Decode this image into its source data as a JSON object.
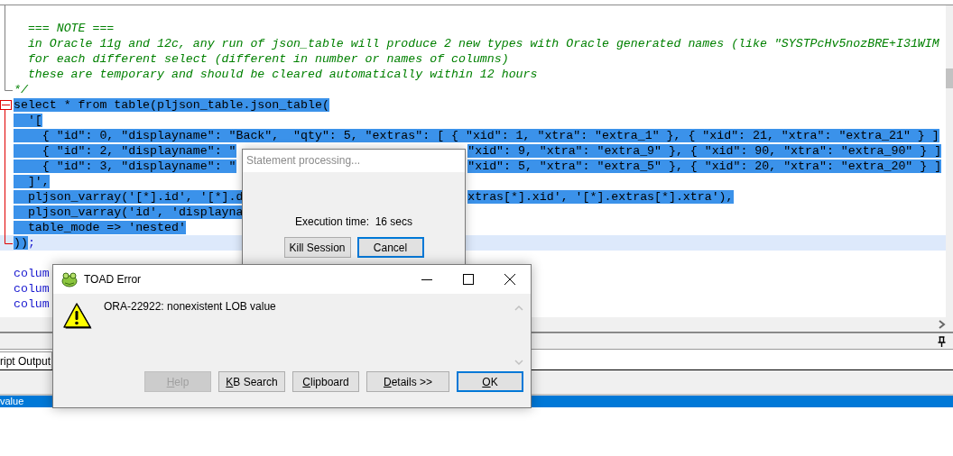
{
  "editor": {
    "lines": [
      {
        "kind": "comment-line"
      },
      {
        "kind": "comment-line",
        "left": [
          {
            "text": "  === NOTE ===",
            "kind": "comment",
            "selected": false
          }
        ]
      },
      {
        "kind": "comment-line",
        "left": [
          {
            "text": "  in Oracle 11g and 12c, any run of json_table will produce 2 new types with Oracle generated names (like \"SYSTPcHv5nozBRE+I31WIM",
            "kind": "comment",
            "selected": false
          }
        ]
      },
      {
        "kind": "comment-line",
        "left": [
          {
            "text": "  for each different select (different in number or names of columns)",
            "kind": "comment",
            "selected": false
          }
        ]
      },
      {
        "kind": "comment-line",
        "left": [
          {
            "text": "  these are temporary and should be cleared automatically within 12 hours",
            "kind": "comment",
            "selected": false
          }
        ]
      },
      {
        "kind": "comment-end",
        "left": [
          {
            "text": "*/",
            "kind": "comment",
            "selected": false
          }
        ]
      },
      {
        "kind": "block-start",
        "left": [
          {
            "text": "select * from table(pljson_table.json_table(",
            "kind": "code",
            "selected": true
          }
        ]
      },
      {
        "kind": "block-line",
        "left": [
          {
            "text": "  '[",
            "kind": "code",
            "selected": true
          }
        ]
      },
      {
        "kind": "block-line",
        "left": [
          {
            "text": "    { \"id\": 0, \"displayname\": \"Back\",  \"qty\": 5, \"extras\": [ { \"xid\": 1, \"xtra\": \"extra_1\" }, { \"xid\": 21, \"xtra\": \"extra_21\" } ]",
            "kind": "code",
            "selected": true
          }
        ]
      },
      {
        "kind": "block-line",
        "left": [
          {
            "text": "    { \"id\": 2, \"displayname\": \"",
            "kind": "code",
            "selected": true
          }
        ],
        "right": [
          {
            "text": "\"xid\": 9, \"xtra\": \"extra_9\" }, { \"xid\": 90, \"xtra\": \"extra_90\" } ]",
            "kind": "code",
            "selected": true
          }
        ]
      },
      {
        "kind": "block-line",
        "left": [
          {
            "text": "    { \"id\": 3, \"displayname\": \"",
            "kind": "code",
            "selected": true
          }
        ],
        "right": [
          {
            "text": "\"xid\": 5, \"xtra\": \"extra_5\" }, { \"xid\": 20, \"xtra\": \"extra_20\" } ]",
            "kind": "code",
            "selected": true
          }
        ]
      },
      {
        "kind": "block-line",
        "left": [
          {
            "text": "  ]',",
            "kind": "code",
            "selected": true
          }
        ]
      },
      {
        "kind": "block-line",
        "left": [
          {
            "text": "  pljson_varray('[*].id', '[*].d",
            "kind": "code",
            "selected": true
          }
        ],
        "right": [
          {
            "text": "xtras[*].xid', '[*].extras[*].xtra'),",
            "kind": "code",
            "selected": true
          }
        ]
      },
      {
        "kind": "block-line",
        "left": [
          {
            "text": "  pljson_varray('id', 'displayna",
            "kind": "code",
            "selected": true
          }
        ]
      },
      {
        "kind": "block-line",
        "left": [
          {
            "text": "  table_mode => 'nested'",
            "kind": "code",
            "selected": true
          }
        ]
      },
      {
        "kind": "block-end",
        "current": true,
        "left": [
          {
            "text": "))",
            "kind": "code",
            "selected": true
          },
          {
            "text": ";",
            "kind": "punct",
            "selected": false
          }
        ]
      },
      {
        "kind": "plain"
      },
      {
        "kind": "plain",
        "left": [
          {
            "text": "colum",
            "kind": "keyword",
            "selected": false
          }
        ]
      },
      {
        "kind": "plain",
        "left": [
          {
            "text": "colum",
            "kind": "keyword",
            "selected": false
          }
        ]
      },
      {
        "kind": "plain",
        "left": [
          {
            "text": "colum",
            "kind": "keyword",
            "selected": false
          }
        ]
      }
    ]
  },
  "output_panel": {
    "tabs": [
      {
        "label": "ript Output",
        "selected": true
      }
    ]
  },
  "status_bar": {
    "text": "value"
  },
  "statement_dialog": {
    "title": "Statement processing...",
    "message": "Execution time:  16 secs",
    "buttons": [
      {
        "label": "Kill Session",
        "focused": false
      },
      {
        "label": "Cancel",
        "focused": true
      }
    ]
  },
  "error_dialog": {
    "title": "TOAD Error",
    "message": "ORA-22922: nonexistent LOB value",
    "buttons": [
      {
        "label": "Help",
        "disabled": true,
        "default": false
      },
      {
        "label": "KB Search",
        "disabled": false,
        "default": false
      },
      {
        "label": "Clipboard",
        "disabled": false,
        "default": false
      },
      {
        "label": "Details >>",
        "disabled": false,
        "default": false
      },
      {
        "label": "OK",
        "disabled": false,
        "default": true
      }
    ]
  }
}
